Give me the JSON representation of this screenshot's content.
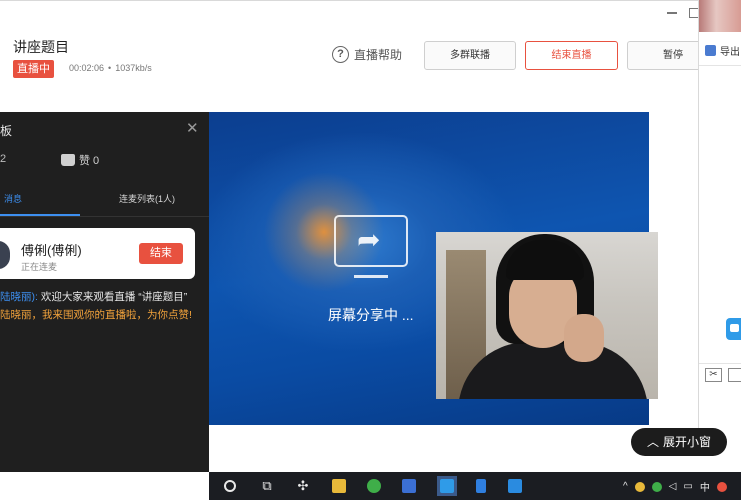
{
  "header": {
    "title": "讲座题目",
    "live_badge": "直播中",
    "duration": "00:02:06",
    "bitrate": "1037kb/s",
    "help_label": "直播帮助",
    "buttons": {
      "multi_group": "多群联播",
      "end_live": "结束直播",
      "pause": "暂停"
    }
  },
  "right_panel": {
    "guide_label": "导出"
  },
  "chat_panel": {
    "title": "板",
    "viewer_count": "2",
    "like_label": "赞 0",
    "tabs": {
      "messages": "消息",
      "mic_list": "连麦列表(1人)"
    },
    "mic_card": {
      "name": "傅俐(傅俐)",
      "status": "正在连麦",
      "end_button": "结束"
    },
    "messages": [
      {
        "user": "陆晓丽):",
        "text": "欢迎大家来观看直播 “讲座题目”"
      },
      {
        "text": "陆晓丽，我来围观你的直播啦，为你点赞!"
      }
    ]
  },
  "stage": {
    "sharing_text": "屏幕分享中 ..."
  },
  "expand_pill": {
    "label": "展开小窗"
  },
  "taskbar": {
    "tray_ime": "中"
  },
  "colors": {
    "accent_red": "#e8513f",
    "accent_blue": "#3d8ff0",
    "dark_panel": "#1f1f1f",
    "taskbar": "#1b1d22"
  }
}
